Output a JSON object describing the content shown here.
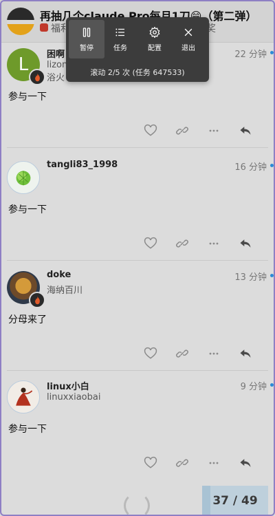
{
  "header": {
    "title": "再抽几个claude Pro每月1刀😁（第二弹）",
    "category": "福利",
    "tag": "奖"
  },
  "toolbar": {
    "pause_label": "暂停",
    "tasks_label": "任务",
    "settings_label": "配置",
    "exit_label": "退出",
    "status": "滚动 2/5 次 (任务 647533)"
  },
  "posts": [
    {
      "username": "困啊",
      "fullname": "lizon",
      "extra": "浴火",
      "time": "22 分钟",
      "body": "参与一下",
      "avatar_letter": "L",
      "avatar_color": "#6e9a2a",
      "has_flair": true
    },
    {
      "username": "tangli83_1998",
      "fullname": "",
      "time": "16 分钟",
      "body": "参与一下",
      "has_flair": false
    },
    {
      "username": "doke",
      "fullname": "海纳百川",
      "time": "13 分钟",
      "body": "分母来了",
      "has_flair": true
    },
    {
      "username": "linux小白",
      "fullname": "linuxxiaobai",
      "time": "9 分钟",
      "body": "参与一下",
      "has_flair": false
    }
  ],
  "progress": {
    "label": "37 / 49",
    "current": 37,
    "total": 49
  },
  "colors": {
    "accent": "#2b8bd6",
    "flair": "#e05a2a",
    "toolbar_bg": "#3c3c3c"
  }
}
